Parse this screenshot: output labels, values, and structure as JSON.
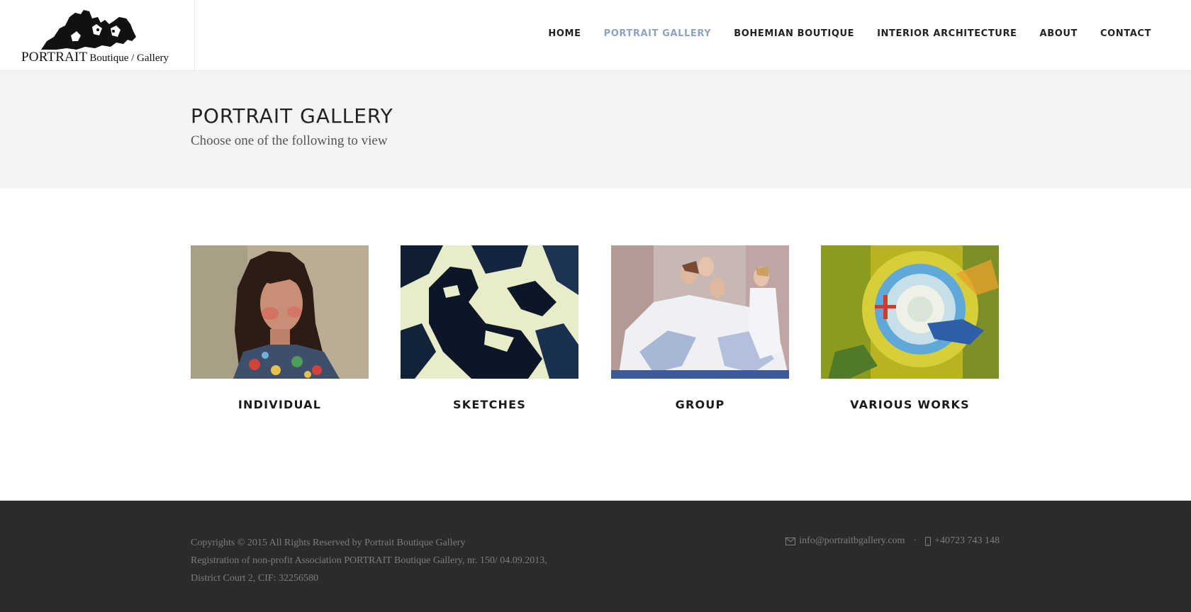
{
  "brand": {
    "logo_main": "PORTRAIT",
    "logo_sub": "Boutique / Gallery"
  },
  "nav": {
    "items": [
      {
        "label": "HOME",
        "active": false
      },
      {
        "label": "PORTRAIT GALLERY",
        "active": true
      },
      {
        "label": "BOHEMIAN BOUTIQUE",
        "active": false
      },
      {
        "label": "INTERIOR ARCHITECTURE",
        "active": false
      },
      {
        "label": "ABOUT",
        "active": false
      },
      {
        "label": "CONTACT",
        "active": false
      }
    ],
    "active_color": "#8ea3c2"
  },
  "page": {
    "title": "PORTRAIT GALLERY",
    "subtitle": "Choose one of the following to view"
  },
  "gallery": {
    "items": [
      {
        "label": "INDIVIDUAL",
        "image": "portrait-of-girl-painting"
      },
      {
        "label": "SKETCHES",
        "image": "blue-figure-sketch-painting"
      },
      {
        "label": "GROUP",
        "image": "group-of-women-painting"
      },
      {
        "label": "VARIOUS WORKS",
        "image": "abstract-swirl-painting"
      }
    ]
  },
  "footer": {
    "copyright": "Copyrights © 2015 All Rights Reserved by Portrait Boutique Gallery",
    "registration_1": "Registration of non-profit Association PORTRAIT Boutique Gallery, nr. 150/ 04.09.2013,",
    "registration_2": "District Court 2, CIF: 32256580",
    "email": "info@portraitbgallery.com",
    "separator": "·",
    "phone": "+40723 743 148",
    "email_icon": "envelope-icon",
    "phone_icon": "mobile-phone-icon"
  }
}
